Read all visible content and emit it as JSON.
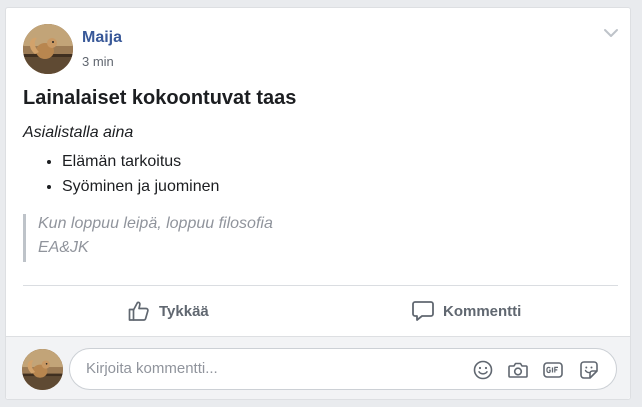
{
  "post": {
    "author": "Maija",
    "timestamp": "3 min",
    "title": "Lainalaiset kokoontuvat taas",
    "subtitle": "Asialistalla aina",
    "list_items": [
      "Elämän tarkoitus",
      "Syöminen ja juominen"
    ],
    "quote_lines": [
      "Kun loppuu leipä, loppuu filosofia",
      "EA&JK"
    ]
  },
  "actions": {
    "like_label": "Tykkää",
    "comment_label": "Kommentti"
  },
  "comment_box": {
    "placeholder": "Kirjoita kommentti..."
  },
  "icons": {
    "options": "chevron-down-icon",
    "like": "thumbs-up-icon",
    "comment": "speech-bubble-icon",
    "emoji": "smiley-icon",
    "camera": "camera-icon",
    "gif": "gif-icon",
    "sticker": "sticker-icon"
  },
  "colors": {
    "author_link": "#385898",
    "text": "#1c1e21",
    "muted": "#606770",
    "quote_text": "#90949c",
    "page_background": "#e9ebee"
  }
}
